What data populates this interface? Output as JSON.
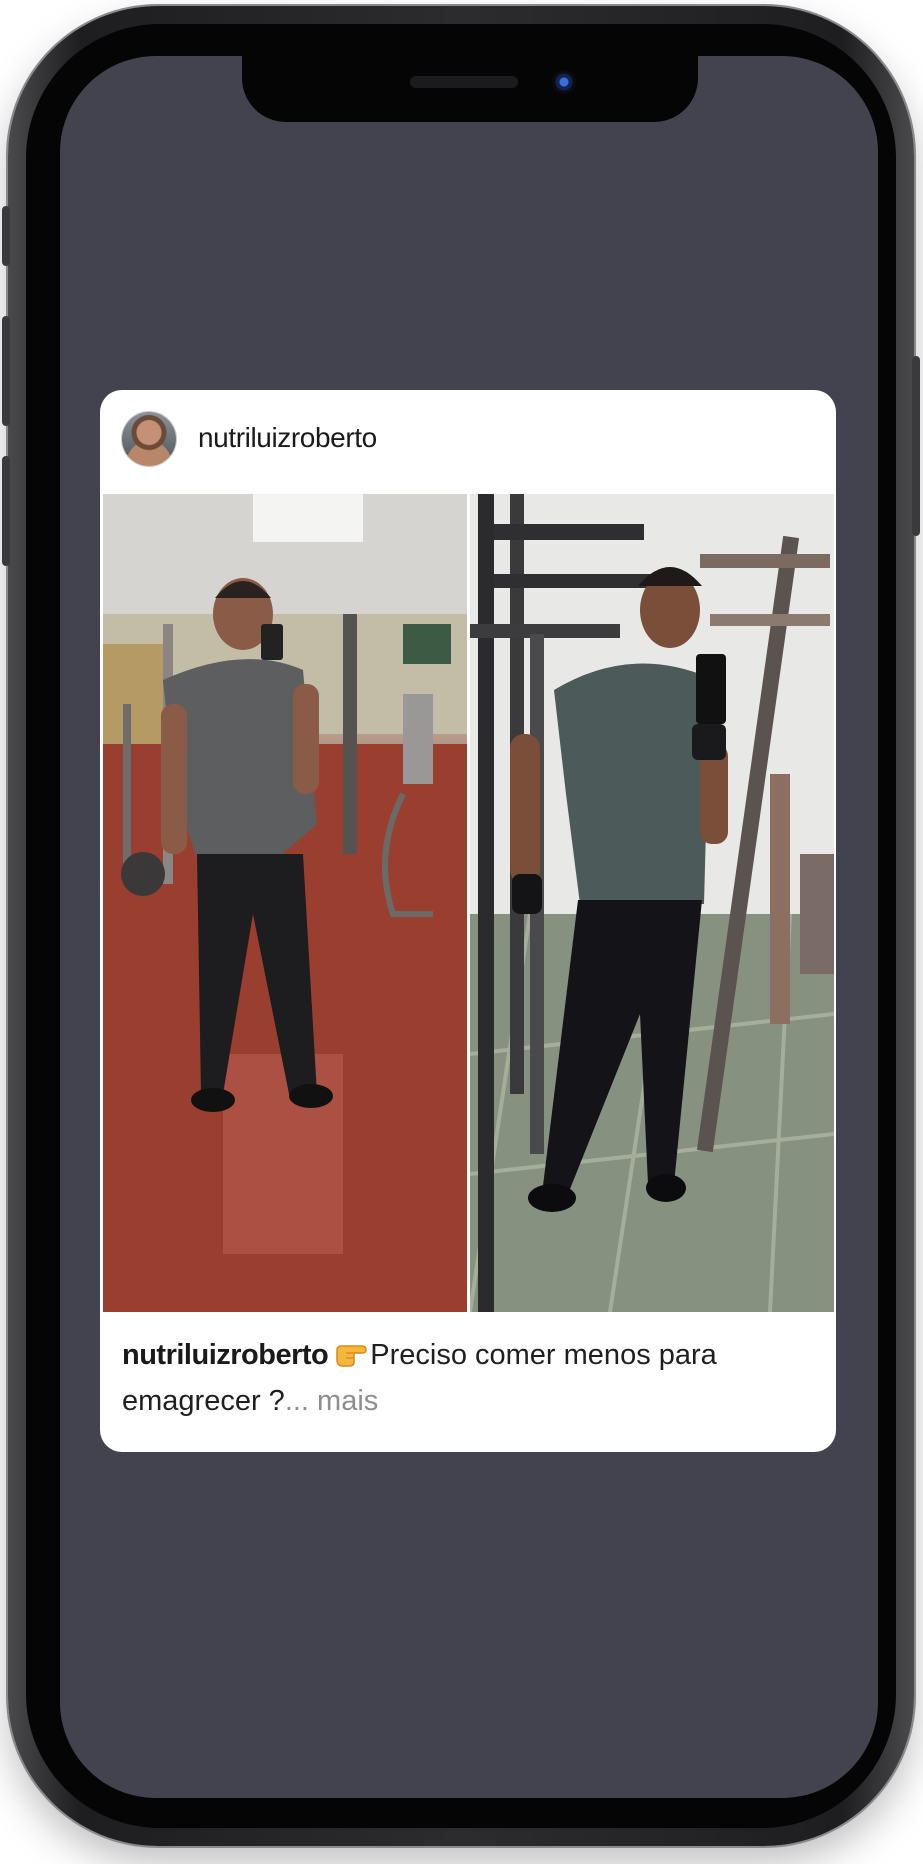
{
  "post": {
    "username": "nutriluizroberto",
    "caption": {
      "username": "nutriluizroberto",
      "text_line1": "Preciso comer menos para",
      "text_line2": "emagrecer ?",
      "ellipsis": "...",
      "more_label": " mais",
      "emoji": "pointing-right-hand-icon"
    },
    "images": [
      {
        "name": "before-photo"
      },
      {
        "name": "after-photo"
      }
    ]
  },
  "colors": {
    "screen_background": "#43424f",
    "card_background": "#ffffff",
    "username_text": "#1a1a1a",
    "more_text": "#8e8e8e"
  }
}
